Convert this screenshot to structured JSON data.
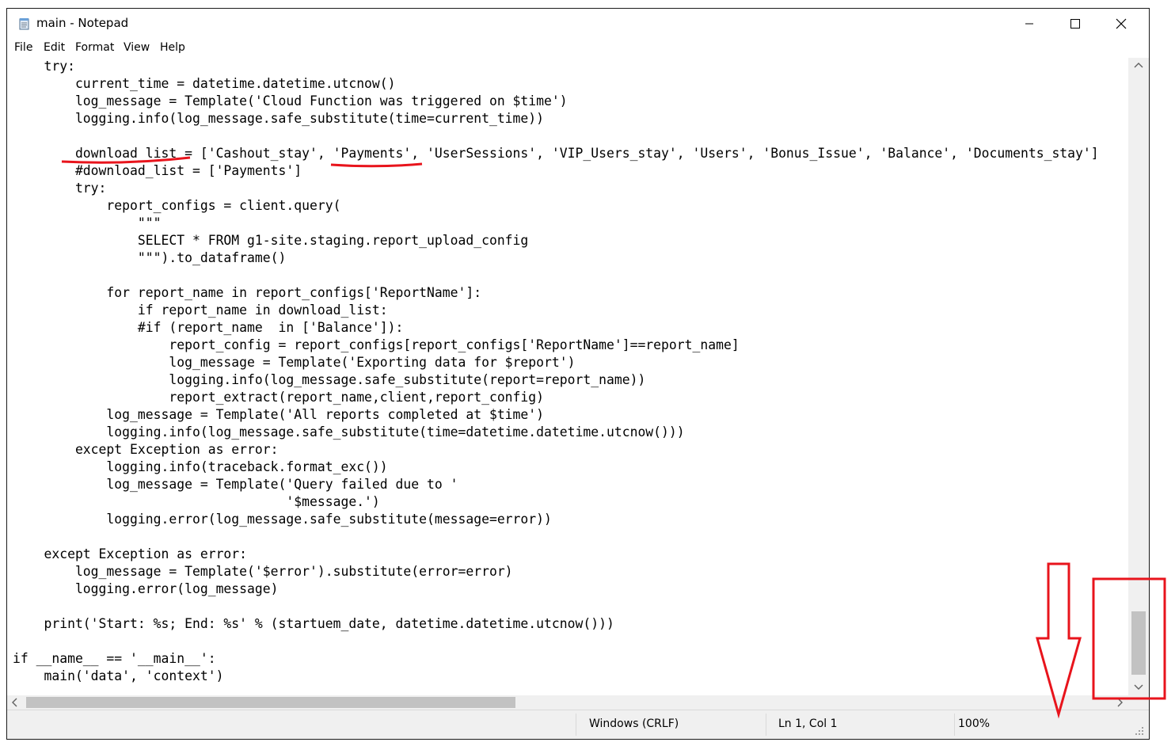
{
  "window": {
    "title": "main - Notepad",
    "menu": [
      "File",
      "Edit",
      "Format",
      "View",
      "Help"
    ]
  },
  "editor": {
    "lines": [
      "    try:",
      "        current_time = datetime.datetime.utcnow()",
      "        log_message = Template('Cloud Function was triggered on $time')",
      "        logging.info(log_message.safe_substitute(time=current_time))",
      "",
      "        download_list = ['Cashout_stay', 'Payments', 'UserSessions', 'VIP_Users_stay', 'Users', 'Bonus_Issue', 'Balance', 'Documents_stay']",
      "        #download_list = ['Payments']",
      "        try:",
      "            report_configs = client.query(",
      "                \"\"\"",
      "                SELECT * FROM g1-site.staging.report_upload_config",
      "                \"\"\").to_dataframe()",
      "",
      "            for report_name in report_configs['ReportName']:",
      "                if report_name in download_list:",
      "                #if (report_name  in ['Balance']):",
      "                    report_config = report_configs[report_configs['ReportName']==report_name]",
      "                    log_message = Template('Exporting data for $report')",
      "                    logging.info(log_message.safe_substitute(report=report_name))",
      "                    report_extract(report_name,client,report_config)",
      "            log_message = Template('All reports completed at $time')",
      "            logging.info(log_message.safe_substitute(time=datetime.datetime.utcnow()))",
      "        except Exception as error:",
      "            logging.info(traceback.format_exc())",
      "            log_message = Template('Query failed due to '",
      "                                   '$message.')",
      "            logging.error(log_message.safe_substitute(message=error))",
      "",
      "    except Exception as error:",
      "        log_message = Template('$error').substitute(error=error)",
      "        logging.error(log_message)",
      "",
      "    print('Start: %s; End: %s' % (startuem_date, datetime.datetime.utcnow()))",
      "",
      "if __name__ == '__main__':",
      "    main('data', 'context')"
    ]
  },
  "statusbar": {
    "line_ending": "Windows (CRLF)",
    "position": "Ln 1, Col 1",
    "zoom": "100%"
  },
  "scroll": {
    "vertical_position_fraction": 0.9,
    "horizontal_position_fraction": 0.0
  },
  "annotation_color": "#e8141c",
  "icons": [
    "notepad-icon",
    "minimize-icon",
    "maximize-icon",
    "close-icon",
    "scroll-up-icon",
    "scroll-down-icon",
    "scroll-left-icon",
    "scroll-right-icon",
    "resize-grip-icon"
  ]
}
